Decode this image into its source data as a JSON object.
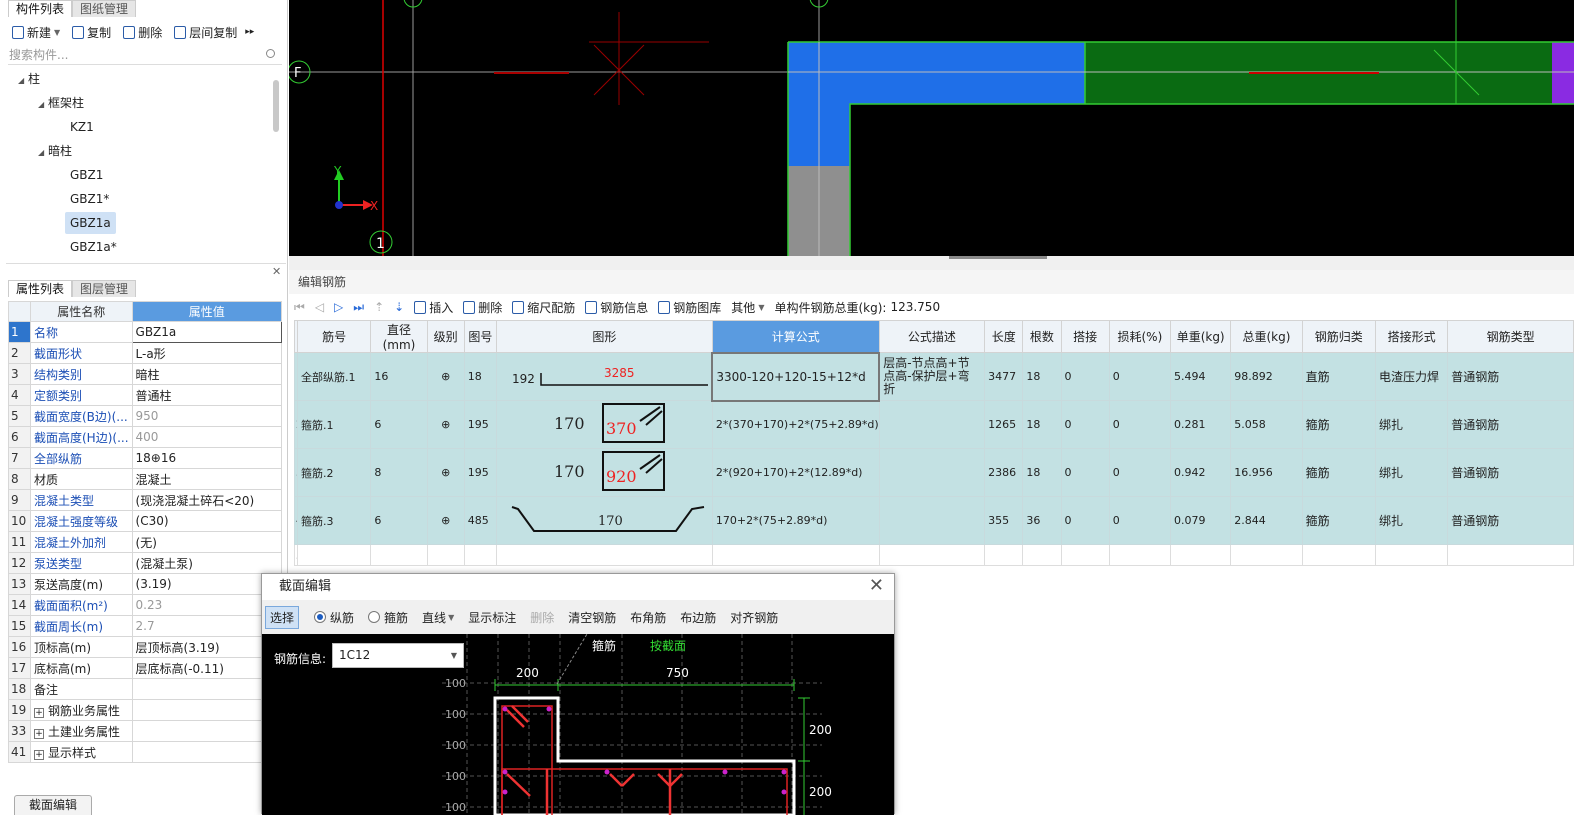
{
  "left_panel": {
    "tabs": [
      "构件列表",
      "图纸管理"
    ],
    "toolbar": {
      "new": "新建",
      "copy": "复制",
      "delete": "删除",
      "floor_copy": "层间复制"
    },
    "search_placeholder": "搜索构件...",
    "tree": {
      "root": "柱",
      "group1": "框架柱",
      "g1_items": [
        "KZ1"
      ],
      "group2": "暗柱",
      "g2_items": [
        "GBZ1",
        "GBZ1*",
        "GBZ1a",
        "GBZ1a*"
      ],
      "selected": "GBZ1a"
    }
  },
  "prop_panel": {
    "tabs": [
      "属性列表",
      "图层管理"
    ],
    "headers": [
      "属性名称",
      "属性值"
    ],
    "rows": [
      {
        "n": "1",
        "k": "名称",
        "v": "GBZ1a"
      },
      {
        "n": "2",
        "k": "截面形状",
        "v": "L-a形"
      },
      {
        "n": "3",
        "k": "结构类别",
        "v": "暗柱"
      },
      {
        "n": "4",
        "k": "定额类别",
        "v": "普通柱"
      },
      {
        "n": "5",
        "k": "截面宽度(B边)(...",
        "v": "950"
      },
      {
        "n": "6",
        "k": "截面高度(H边)(...",
        "v": "400"
      },
      {
        "n": "7",
        "k": "全部纵筋",
        "v": "18⊕16"
      },
      {
        "n": "8",
        "k": "材质",
        "v": "混凝土"
      },
      {
        "n": "9",
        "k": "混凝土类型",
        "v": "(现浇混凝土碎石<20)"
      },
      {
        "n": "10",
        "k": "混凝土强度等级",
        "v": "(C30)"
      },
      {
        "n": "11",
        "k": "混凝土外加剂",
        "v": "(无)"
      },
      {
        "n": "12",
        "k": "泵送类型",
        "v": "(混凝土泵)"
      },
      {
        "n": "13",
        "k": "泵送高度(m)",
        "v": "(3.19)"
      },
      {
        "n": "14",
        "k": "截面面积(m²)",
        "v": "0.23"
      },
      {
        "n": "15",
        "k": "截面周长(m)",
        "v": "2.7"
      },
      {
        "n": "16",
        "k": "顶标高(m)",
        "v": "层顶标高(3.19)"
      },
      {
        "n": "17",
        "k": "底标高(m)",
        "v": "层底标高(-0.11)"
      },
      {
        "n": "18",
        "k": "备注",
        "v": ""
      },
      {
        "n": "19",
        "k": "钢筋业务属性",
        "v": ""
      },
      {
        "n": "33",
        "k": "土建业务属性",
        "v": ""
      },
      {
        "n": "41",
        "k": "显示样式",
        "v": ""
      }
    ]
  },
  "cad": {
    "axis_labels": {
      "f": "F",
      "one": "1",
      "y": "Y",
      "x": "X"
    }
  },
  "rebar_editor": {
    "title": "编辑钢筋",
    "toolbar": {
      "insert": "插入",
      "delete": "删除",
      "scale": "缩尺配筋",
      "info": "钢筋信息",
      "library": "钢筋图库",
      "other": "其他",
      "total_label": "单构件钢筋总重(kg):",
      "total_value": "123.750"
    },
    "headers": [
      "筋号",
      "直径(mm)",
      "级别",
      "图号",
      "图形",
      "计算公式",
      "公式描述",
      "长度",
      "根数",
      "搭接",
      "损耗(%)",
      "单重(kg)",
      "总重(kg)",
      "钢筋归类",
      "搭接形式",
      "钢筋类型"
    ],
    "rows": [
      {
        "n": "1",
        "name": "全部纵筋.1",
        "dia": "16",
        "grade": "⊕",
        "fig": "18",
        "shape": {
          "left": "192",
          "mid": "3285"
        },
        "formula": "3300-120+120-15+12*d",
        "desc": "层高-节点高+节点高-保护层+弯折",
        "len": "3477",
        "count": "18",
        "lap": "0",
        "loss": "0",
        "unit": "5.494",
        "total": "98.892",
        "cat": "直筋",
        "lapform": "电渣压力焊",
        "type": "普通钢筋"
      },
      {
        "n": "2",
        "name": "箍筋.1",
        "dia": "6",
        "grade": "⊕",
        "fig": "195",
        "shape": {
          "left": "170",
          "mid": "370"
        },
        "formula": "2*(370+170)+2*(75+2.89*d)",
        "desc": "",
        "len": "1265",
        "count": "18",
        "lap": "0",
        "loss": "0",
        "unit": "0.281",
        "total": "5.058",
        "cat": "箍筋",
        "lapform": "绑扎",
        "type": "普通钢筋"
      },
      {
        "n": "3",
        "name": "箍筋.2",
        "dia": "8",
        "grade": "⊕",
        "fig": "195",
        "shape": {
          "left": "170",
          "mid": "920"
        },
        "formula": "2*(920+170)+2*(12.89*d)",
        "desc": "",
        "len": "2386",
        "count": "18",
        "lap": "0",
        "loss": "0",
        "unit": "0.942",
        "total": "16.956",
        "cat": "箍筋",
        "lapform": "绑扎",
        "type": "普通钢筋"
      },
      {
        "n": "4",
        "name": "箍筋.3",
        "dia": "6",
        "grade": "⊕",
        "fig": "485",
        "shape": {
          "left": "",
          "mid": "170"
        },
        "formula": "170+2*(75+2.89*d)",
        "desc": "",
        "len": "355",
        "count": "36",
        "lap": "0",
        "loss": "0",
        "unit": "0.079",
        "total": "2.844",
        "cat": "箍筋",
        "lapform": "绑扎",
        "type": "普通钢筋"
      }
    ],
    "empty_row": "5"
  },
  "section_dialog": {
    "title": "截面编辑",
    "toolbar": {
      "select": "选择",
      "longitudinal": "纵筋",
      "stirrup": "箍筋",
      "line": "直线",
      "show_dim": "显示标注",
      "delete": "删除",
      "clear": "清空钢筋",
      "corner": "布角筋",
      "edge": "布边筋",
      "align": "对齐钢筋"
    },
    "rebar_info_label": "钢筋信息:",
    "rebar_info_value": "1C12",
    "canvas_labels": {
      "stirrup": "箍筋",
      "by_section": "按截面",
      "dim_left": "200",
      "dim_top": "750",
      "dim_r1": "200",
      "dim_r2": "200",
      "grid": [
        "100",
        "100",
        "100",
        "100",
        "100",
        "100"
      ]
    }
  },
  "bottom_tab": "截面编辑",
  "colors": {
    "accent": "#5a9be0",
    "row_bg": "#c3e1e3",
    "cad_blue": "#1f6fe8",
    "cad_green": "#0a6b12",
    "cad_purple": "#8a2be2"
  }
}
